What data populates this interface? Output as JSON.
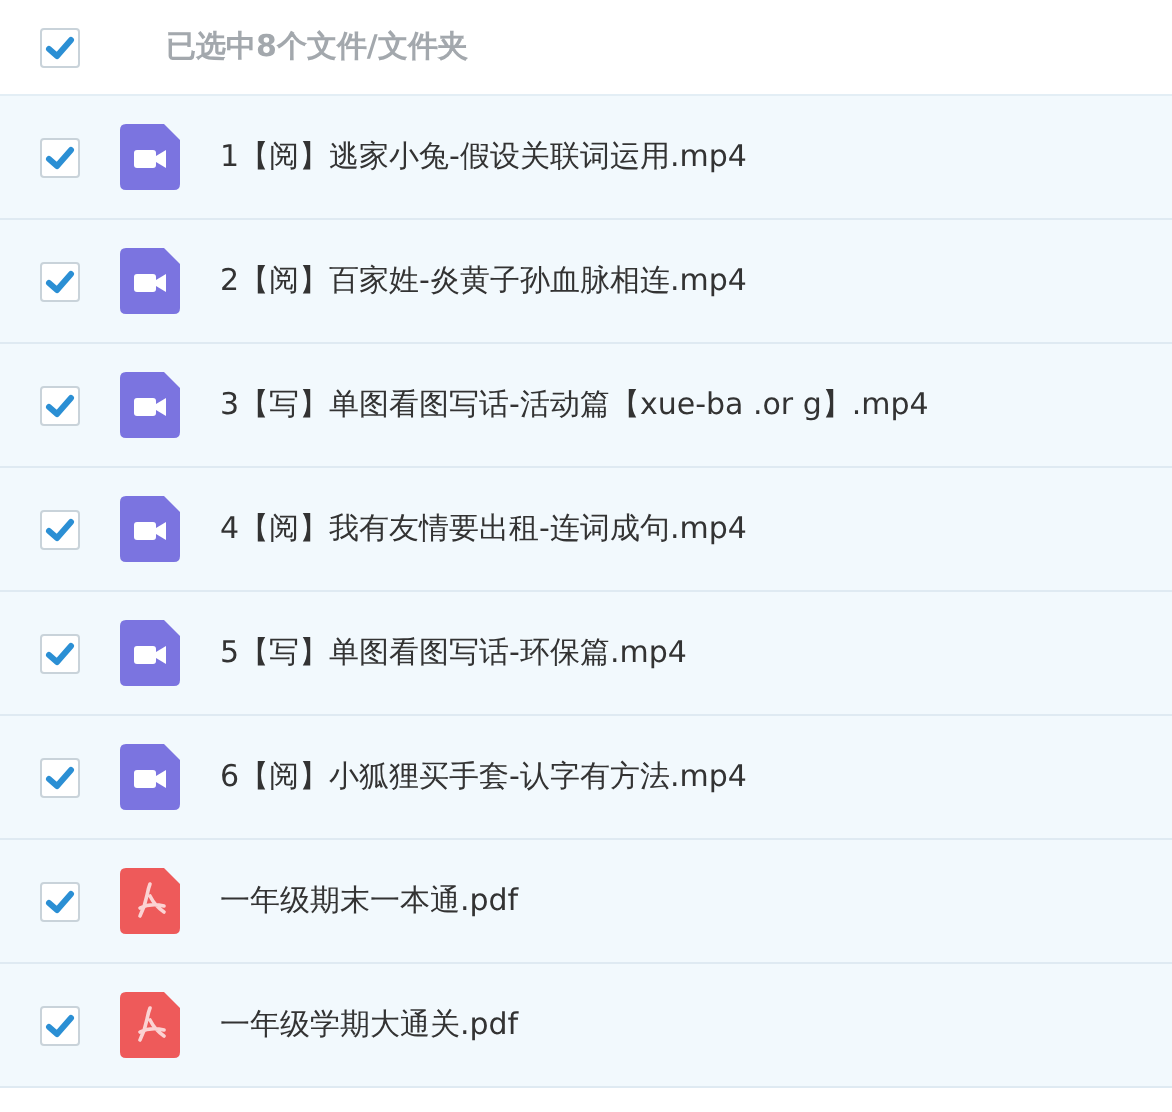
{
  "header": {
    "checked": true,
    "label": "已选中8个文件/文件夹"
  },
  "files": [
    {
      "name": "1【阅】逃家小兔-假设关联词运用.mp4",
      "kind": "video",
      "checked": true
    },
    {
      "name": "2【阅】百家姓-炎黄子孙血脉相连.mp4",
      "kind": "video",
      "checked": true
    },
    {
      "name": "3【写】单图看图写话-活动篇【xue-ba .or g】.mp4",
      "kind": "video",
      "checked": true
    },
    {
      "name": "4【阅】我有友情要出租-连词成句.mp4",
      "kind": "video",
      "checked": true
    },
    {
      "name": "5【写】单图看图写话-环保篇.mp4",
      "kind": "video",
      "checked": true
    },
    {
      "name": "6【阅】小狐狸买手套-认字有方法.mp4",
      "kind": "video",
      "checked": true
    },
    {
      "name": "一年级期末一本通.pdf",
      "kind": "pdf",
      "checked": true
    },
    {
      "name": "一年级学期大通关.pdf",
      "kind": "pdf",
      "checked": true
    }
  ]
}
